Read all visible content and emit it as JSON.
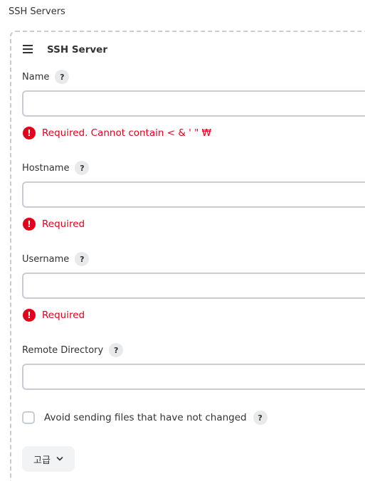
{
  "section": {
    "title": "SSH Servers"
  },
  "card": {
    "title": "SSH Server"
  },
  "fields": {
    "name": {
      "label": "Name",
      "value": "",
      "error": "Required. Cannot contain < & ' \" ₩"
    },
    "hostname": {
      "label": "Hostname",
      "value": "",
      "error": "Required"
    },
    "username": {
      "label": "Username",
      "value": "",
      "error": "Required"
    },
    "remote_directory": {
      "label": "Remote Directory",
      "value": ""
    }
  },
  "checkbox": {
    "label": "Avoid sending files that have not changed",
    "checked": false
  },
  "advanced": {
    "label": "고급"
  },
  "icons": {
    "help": "?",
    "error": "!"
  },
  "colors": {
    "error": "#e2001b",
    "border": "#c9cdd1",
    "help_bg": "#e8e9ea"
  }
}
